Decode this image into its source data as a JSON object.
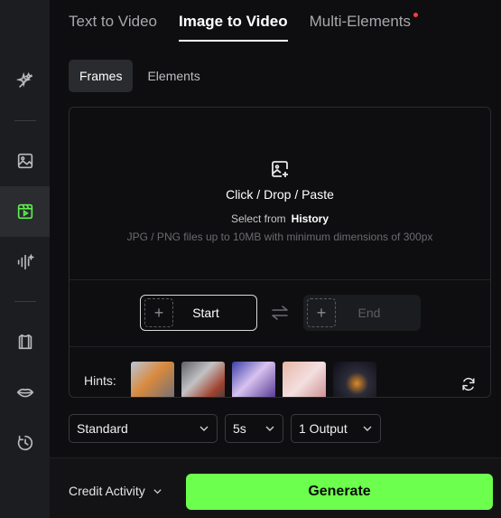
{
  "tabs": [
    {
      "label": "Text to Video"
    },
    {
      "label": "Image to Video"
    },
    {
      "label": "Multi-Elements"
    }
  ],
  "segments": [
    {
      "label": "Frames"
    },
    {
      "label": "Elements"
    }
  ],
  "upload": {
    "cta": "Click / Drop / Paste",
    "select_from": "Select from",
    "history_link": "History",
    "hint": "JPG / PNG files up to 10MB with minimum dimensions of 300px"
  },
  "frames": {
    "start_label": "Start",
    "end_label": "End"
  },
  "hints": {
    "label": "Hints:"
  },
  "options": {
    "quality": "Standard",
    "duration": "5s",
    "outputs": "1 Output"
  },
  "footer": {
    "credit_label": "Credit Activity",
    "generate_label": "Generate"
  },
  "colors": {
    "accent": "#6cff4d",
    "notification_dot": "#ff3b3b",
    "sidebar_active_icon": "#5cf04a"
  }
}
